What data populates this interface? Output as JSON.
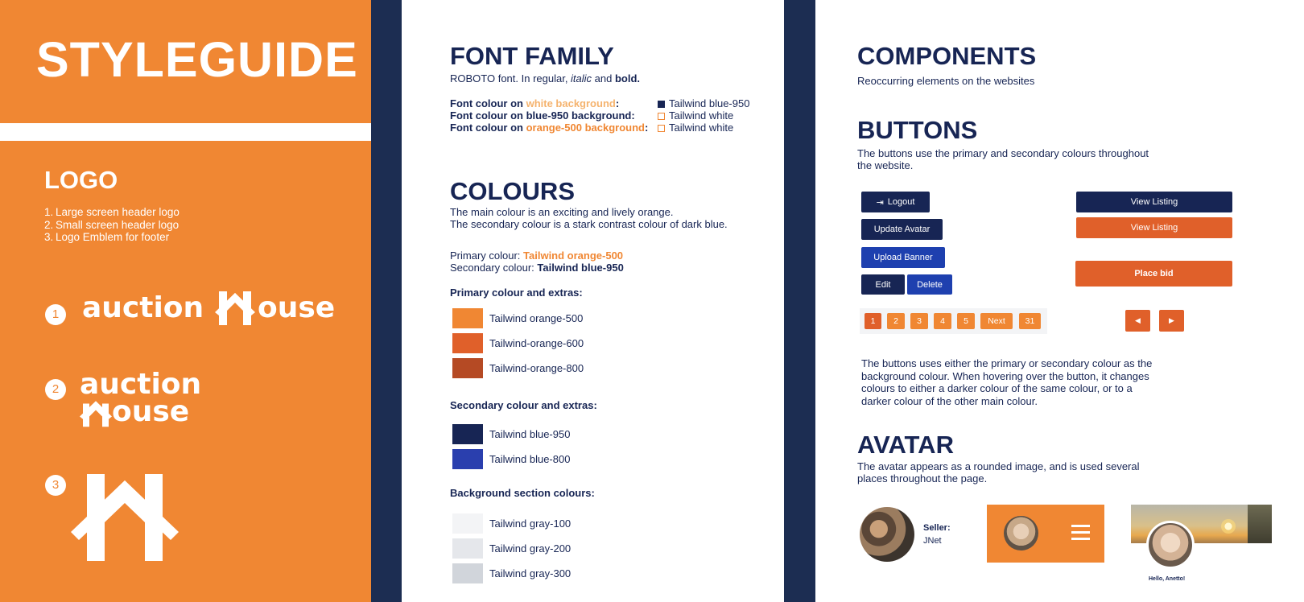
{
  "left": {
    "title": "STYLEGUIDE",
    "logo_heading": "LOGO",
    "logo_list": [
      "Large screen header logo",
      "Small screen header logo",
      "Logo Emblem for footer"
    ],
    "logo_list_numbers": [
      "1.",
      "2.",
      "3."
    ],
    "markers": [
      "1",
      "2",
      "3"
    ],
    "wordmark_line1": "auction",
    "wordmark_house_rest": "ouse",
    "wordmark_house_big": "auction",
    "wordmark_house_small": "ouse"
  },
  "font": {
    "heading": "FONT FAMILY",
    "intro_a": "ROBOTO font. In regular, ",
    "intro_italic": "italic",
    "intro_b": " and ",
    "intro_bold": "bold.",
    "row1_a": "Font colour on ",
    "row1_b": "white background",
    "row1_c": ":",
    "row2": "Font colour on blue-950 background:",
    "row3_a": "Font colour on ",
    "row3_b": "orange-500 background",
    "row3_c": ":",
    "val1": "Tailwind blue-950",
    "val2": "Tailwind white",
    "val3": "Tailwind white"
  },
  "colours": {
    "heading": "COLOURS",
    "line1": "The main colour is an exciting and lively orange.",
    "line2": "The secondary colour is a stark contrast colour of dark blue.",
    "primary_label": "Primary colour: ",
    "primary_value": "Tailwind orange-500",
    "secondary_label": "Secondary colour: ",
    "secondary_value": "Tailwind blue-950",
    "primary_extras_heading": "Primary colour and extras:",
    "secondary_extras_heading": "Secondary colour and extras:",
    "background_heading": "Background section colours:",
    "primary_swatches": [
      {
        "label": "Tailwind orange-500",
        "color": "#F08733"
      },
      {
        "label": "Tailwind-orange-600",
        "color": "#E0602A"
      },
      {
        "label": "Tailwind-orange-800",
        "color": "#B54A24"
      }
    ],
    "secondary_swatches": [
      {
        "label": "Tailwind blue-950",
        "color": "#172554"
      },
      {
        "label": "Tailwind blue-800",
        "color": "#2A3FAE"
      }
    ],
    "background_swatches": [
      {
        "label": "Tailwind gray-100",
        "color": "#F3F4F6"
      },
      {
        "label": "Tailwind gray-200",
        "color": "#E5E7EB"
      },
      {
        "label": "Tailwind gray-300",
        "color": "#D1D5DB"
      }
    ]
  },
  "components": {
    "heading": "COMPONENTS",
    "subtitle": "Reoccurring elements on the websites",
    "buttons_heading": "BUTTONS",
    "buttons_desc1": "The buttons use the primary and secondary colours throughout",
    "buttons_desc2": "the website.",
    "btn_logout": "Logout",
    "btn_update_avatar": "Update Avatar",
    "btn_upload_banner": "Upload Banner",
    "btn_edit": "Edit",
    "btn_delete": "Delete",
    "btn_view_listing_1": "View Listing",
    "btn_view_listing_2": "View Listing",
    "btn_place_bid": "Place bid",
    "pagination": [
      "1",
      "2",
      "3",
      "4",
      "5",
      "Next",
      "31"
    ],
    "prev_arrow": "◀",
    "next_arrow": "▶",
    "hover_desc": [
      "The buttons uses either the primary or secondary colour as the",
      "background colour. When hovering over the button, it changes",
      "colours to either a darker colour of the same colour, or to a",
      "darker colour of the other main colour."
    ],
    "avatar_heading": "AVATAR",
    "avatar_desc1": "The avatar appears as a rounded image, and is used several",
    "avatar_desc2": "places throughout the page.",
    "seller_label": "Seller:",
    "seller_name": "JNet",
    "greeting": "Hello, Anetto!"
  }
}
